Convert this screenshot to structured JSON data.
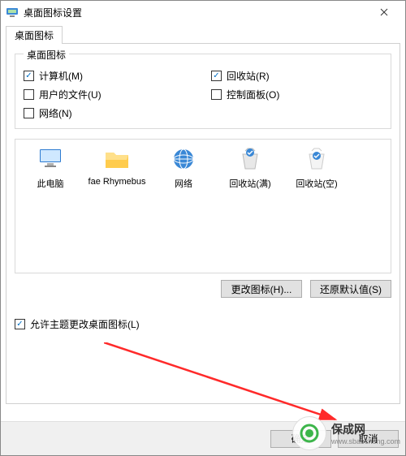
{
  "window": {
    "title": "桌面图标设置"
  },
  "tab": {
    "label": "桌面图标"
  },
  "group": {
    "legend": "桌面图标",
    "items": [
      {
        "label": "计算机(M)",
        "checked": true
      },
      {
        "label": "回收站(R)",
        "checked": true
      },
      {
        "label": "用户的文件(U)",
        "checked": false
      },
      {
        "label": "控制面板(O)",
        "checked": false
      },
      {
        "label": "网络(N)",
        "checked": false
      }
    ]
  },
  "icons": [
    {
      "name": "computer-icon",
      "label": "此电脑"
    },
    {
      "name": "userfolder-icon",
      "label": "fae Rhymebus"
    },
    {
      "name": "network-icon",
      "label": "网络"
    },
    {
      "name": "recyclebin-full-icon",
      "label": "回收站(满)"
    },
    {
      "name": "recyclebin-empty-icon",
      "label": "回收站(空)"
    }
  ],
  "buttons": {
    "changeIcon": "更改图标(H)...",
    "restoreDefault": "还原默认值(S)"
  },
  "themeCheckbox": {
    "label": "允许主题更改桌面图标(L)",
    "checked": true
  },
  "footer": {
    "ok": "确定",
    "cancel": "取消"
  },
  "watermark": {
    "text": "保成网",
    "sub": "www.sbaocheng.com"
  }
}
